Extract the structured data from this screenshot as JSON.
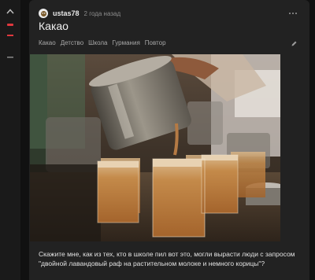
{
  "post": {
    "username": "ustas78",
    "time": "2 года назад",
    "title": "Какао",
    "tags": [
      "Какао",
      "Детство",
      "Школа",
      "Гурмания",
      "Повтор"
    ],
    "description": "Скажите мне, как из тех, кто в школе пил вот это, могли вырасти люди с запросом \"двойной лавандовый раф на растительном молоке и немного корицы\"?"
  },
  "icons": {
    "upvote": "chevron-up-icon",
    "downvote": "minus-icon",
    "hide": "dash-icon",
    "more": "more-dots-icon",
    "edit": "pencil-icon",
    "avatar": "avatar-icon"
  },
  "colors": {
    "background": "#111111",
    "card": "#222222",
    "downvote": "#e0383e",
    "muted_text": "#a8a8a8"
  }
}
